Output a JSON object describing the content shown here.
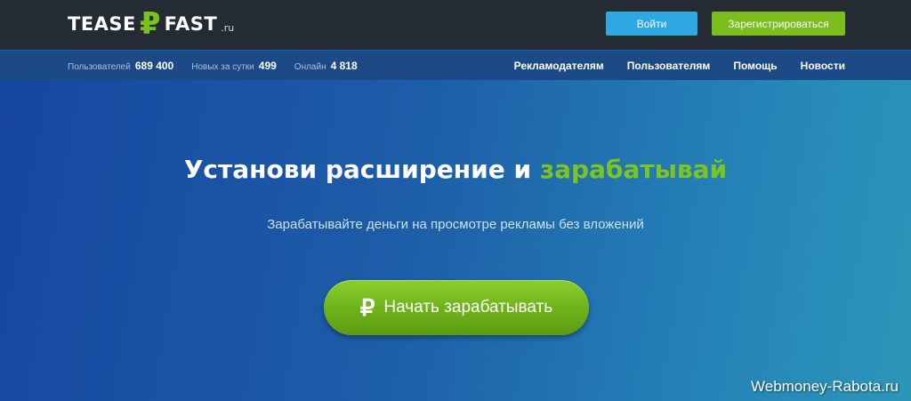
{
  "header": {
    "logo": {
      "left": "TEASE",
      "right": "FAST",
      "tld": ".ru",
      "symbol": "₽"
    },
    "login_label": "Войти",
    "register_label": "Зарегистрироваться"
  },
  "stats": [
    {
      "label": "Пользователей",
      "value": "689 400"
    },
    {
      "label": "Новых за сутки",
      "value": "499"
    },
    {
      "label": "Онлайн",
      "value": "4 818"
    }
  ],
  "nav": [
    {
      "label": "Рекламодателям"
    },
    {
      "label": "Пользователям"
    },
    {
      "label": "Помощь"
    },
    {
      "label": "Новости"
    }
  ],
  "hero": {
    "title_main": "Установи расширение и ",
    "title_accent": "зарабатывай",
    "subtitle": "Зарабатывайте деньги на просмотре рекламы без вложений",
    "cta_icon": "₽",
    "cta_label": "Начать зарабатывать"
  },
  "watermark": "Webmoney-Rabota.ru",
  "colors": {
    "header_bg": "#252b33",
    "accent_green": "#7cbd1e",
    "login_blue": "#2ea8e0"
  }
}
